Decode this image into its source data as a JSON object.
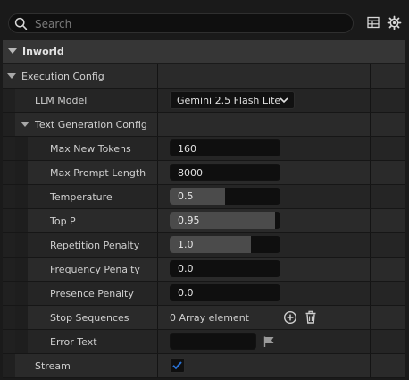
{
  "search": {
    "placeholder": "Search",
    "value": ""
  },
  "toolbar": {
    "table_icon": "table-view-icon",
    "settings_icon": "gear-icon"
  },
  "category": {
    "title": "Inworld"
  },
  "sections": {
    "execution_config": "Execution Config",
    "text_generation_config": "Text Generation Config"
  },
  "properties": {
    "llm_model": {
      "label": "LLM Model",
      "value": "Gemini 2.5 Flash Lite"
    },
    "max_new_tokens": {
      "label": "Max New Tokens",
      "value": "160"
    },
    "max_prompt_length": {
      "label": "Max Prompt Length",
      "value": "8000"
    },
    "temperature": {
      "label": "Temperature",
      "value": "0.5",
      "fill": 0.5
    },
    "top_p": {
      "label": "Top P",
      "value": "0.95",
      "fill": 0.95
    },
    "repetition_penalty": {
      "label": "Repetition Penalty",
      "value": "1.0",
      "fill": 0.73
    },
    "frequency_penalty": {
      "label": "Frequency Penalty",
      "value": "0.0",
      "fill": 0
    },
    "presence_penalty": {
      "label": "Presence Penalty",
      "value": "0.0",
      "fill": 0
    },
    "stop_sequences": {
      "label": "Stop Sequences",
      "value": "0 Array element"
    },
    "error_text": {
      "label": "Error Text",
      "value": ""
    },
    "stream": {
      "label": "Stream",
      "checked": true
    }
  },
  "colors": {
    "accent": "#2a73d6",
    "panel_bg": "#1a1a1a",
    "row_bg": "#252525",
    "field_bg": "#0f0f0f"
  }
}
